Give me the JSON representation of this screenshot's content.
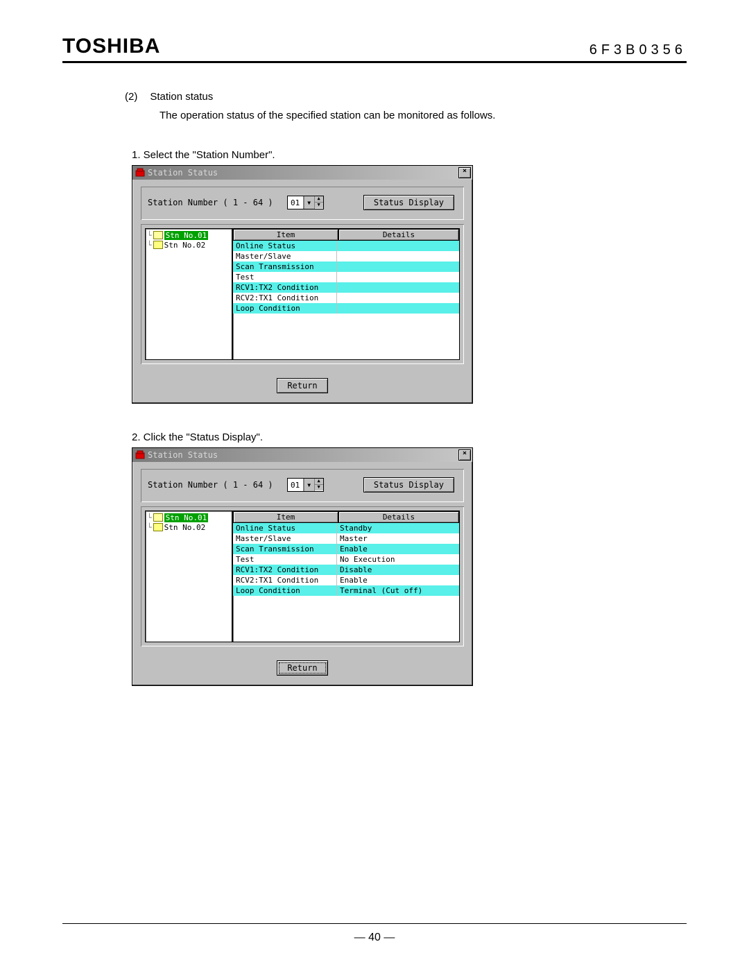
{
  "header": {
    "logo": "TOSHIBA",
    "docid": "6F3B0356"
  },
  "section": {
    "num": "(2)",
    "title": "Station status",
    "desc": "The operation status of the specified station can be monitored as follows."
  },
  "steps": {
    "s1": "1. Select the \"Station Number\".",
    "s2": "2. Click the \"Status Display\"."
  },
  "dialog": {
    "title": "Station Status",
    "close_glyph": "×",
    "stn_label": "Station Number ( 1 - 64 )",
    "spin_value": "01",
    "drop_glyph": "▼",
    "up_glyph": "▲",
    "down_glyph": "▼",
    "status_btn": "Status Display",
    "return_btn": "Return",
    "cols": {
      "item": "Item",
      "details": "Details"
    },
    "tree": [
      {
        "label": "Stn No.01",
        "selected": true,
        "branch": "└"
      },
      {
        "label": "Stn No.02",
        "selected": false,
        "branch": "└"
      }
    ],
    "rows1": [
      {
        "item": "Online Status",
        "details": ""
      },
      {
        "item": "Master/Slave",
        "details": ""
      },
      {
        "item": "Scan Transmission",
        "details": ""
      },
      {
        "item": "Test",
        "details": ""
      },
      {
        "item": "RCV1:TX2 Condition",
        "details": ""
      },
      {
        "item": "RCV2:TX1 Condition",
        "details": ""
      },
      {
        "item": "Loop Condition",
        "details": ""
      }
    ],
    "rows2": [
      {
        "item": "Online Status",
        "details": "Standby"
      },
      {
        "item": "Master/Slave",
        "details": "Master"
      },
      {
        "item": "Scan Transmission",
        "details": "Enable"
      },
      {
        "item": "Test",
        "details": "No Execution"
      },
      {
        "item": "RCV1:TX2 Condition",
        "details": "Disable"
      },
      {
        "item": "RCV2:TX1 Condition",
        "details": "Enable"
      },
      {
        "item": "Loop Condition",
        "details": "Terminal (Cut off)"
      }
    ]
  },
  "footer": {
    "page": "― 40 ―"
  }
}
